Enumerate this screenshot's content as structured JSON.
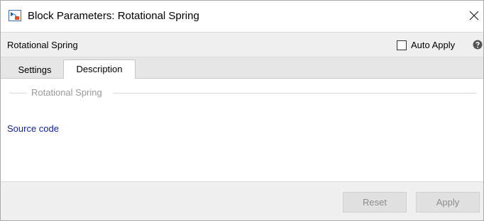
{
  "window": {
    "title": "Block Parameters: Rotational Spring"
  },
  "header": {
    "block_name": "Rotational Spring",
    "auto_apply_label": "Auto Apply",
    "auto_apply_checked": false
  },
  "tabs": [
    {
      "label": "Settings",
      "active": false
    },
    {
      "label": "Description",
      "active": true
    }
  ],
  "description": {
    "group_title": "Rotational Spring",
    "source_link": "Source code"
  },
  "footer": {
    "reset_label": "Reset",
    "apply_label": "Apply"
  },
  "icons": {
    "app": "simulink-block-icon",
    "close": "close-icon",
    "help": "help-icon"
  },
  "colors": {
    "link": "#0e1e9b",
    "disabled_text": "#8c8c8c",
    "panel_bg": "#f0f0f0"
  }
}
